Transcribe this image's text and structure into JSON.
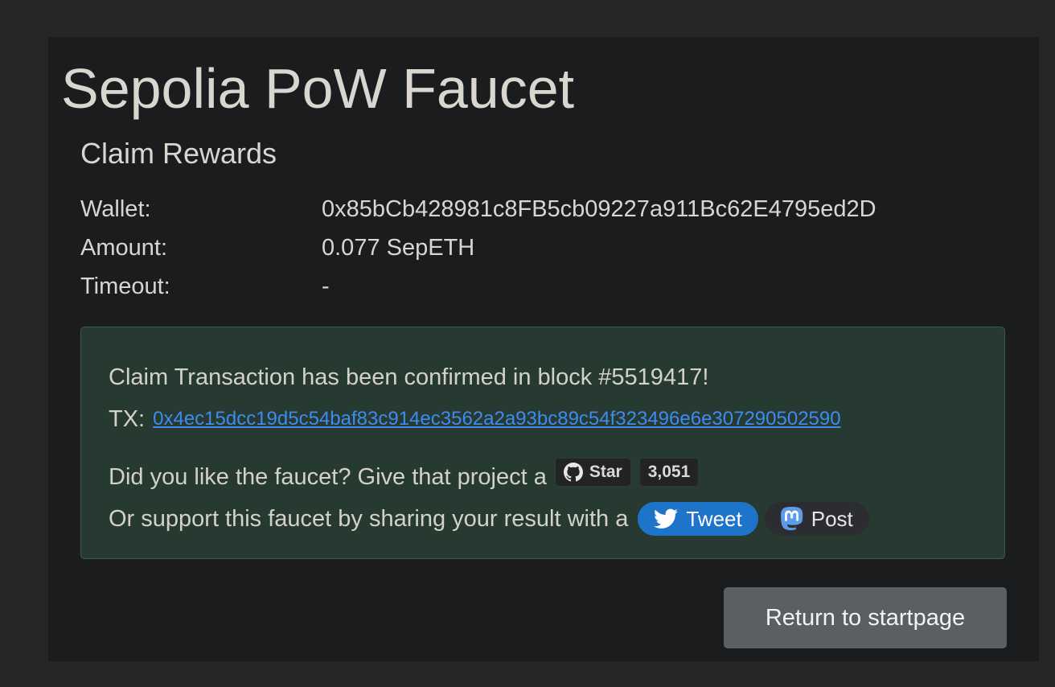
{
  "page": {
    "title": "Sepolia PoW Faucet"
  },
  "claim": {
    "heading": "Claim Rewards",
    "rows": [
      {
        "label": "Wallet:",
        "value": "0x85bCb428981c8FB5cb09227a911Bc62E4795ed2D"
      },
      {
        "label": "Amount:",
        "value": "0.077 SepETH"
      },
      {
        "label": "Timeout:",
        "value": "-"
      }
    ]
  },
  "alert": {
    "confirmed_text": "Claim Transaction has been confirmed in block #5519417!",
    "tx_label": "TX:",
    "tx_hash": "0x4ec15dcc19d5c54baf83c914ec3562a2a93bc89c54f323496e6e307290502590",
    "like_text": "Did you like the faucet? Give that project a",
    "github_star_label": "Star",
    "github_star_count": "3,051",
    "support_text": "Or support this faucet by sharing your result with a",
    "tweet_label": "Tweet",
    "post_label": "Post",
    "bg_color": "#263a32",
    "link_color": "#3d8bf0"
  },
  "actions": {
    "return_label": "Return to startpage"
  },
  "icons": {
    "github": "github-icon",
    "twitter": "twitter-bird-icon",
    "mastodon": "mastodon-icon"
  }
}
